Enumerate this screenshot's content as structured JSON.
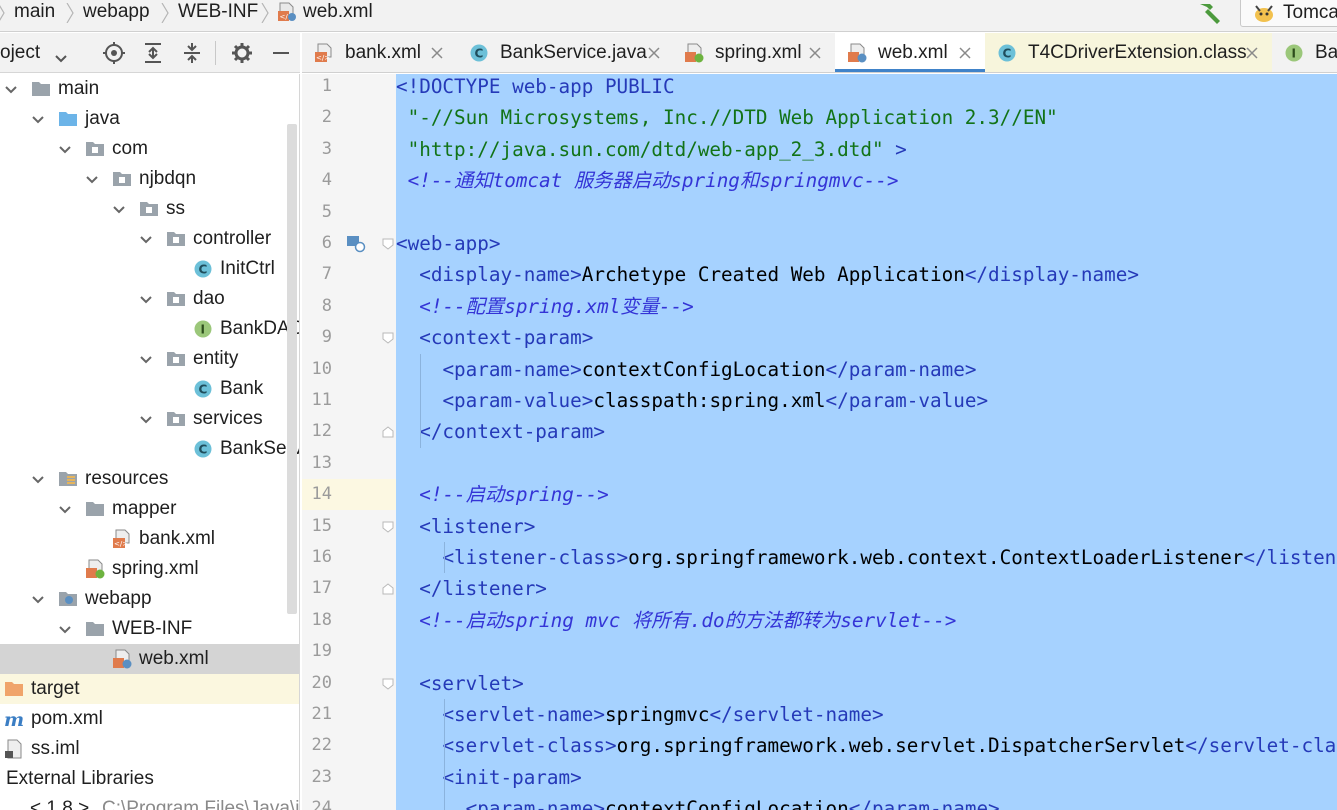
{
  "breadcrumb": [
    "main",
    "webapp",
    "WEB-INF",
    "web.xml"
  ],
  "toolbar": {
    "run_config_label": "Tomca"
  },
  "project_panel": {
    "title": "oject"
  },
  "tree": [
    {
      "label": "main",
      "chevron": "down",
      "icon": "folder-gray"
    },
    {
      "label": "java",
      "chevron": "down",
      "icon": "folder-blue"
    },
    {
      "label": "com",
      "chevron": "down",
      "icon": "package"
    },
    {
      "label": "njbdqn",
      "chevron": "down",
      "icon": "package"
    },
    {
      "label": "ss",
      "chevron": "down",
      "icon": "package"
    },
    {
      "label": "controller",
      "chevron": "down",
      "icon": "package"
    },
    {
      "label": "InitCtrl",
      "chevron": "",
      "icon": "class"
    },
    {
      "label": "dao",
      "chevron": "down",
      "icon": "package"
    },
    {
      "label": "BankDAO",
      "chevron": "",
      "icon": "interface"
    },
    {
      "label": "entity",
      "chevron": "down",
      "icon": "package"
    },
    {
      "label": "Bank",
      "chevron": "",
      "icon": "class"
    },
    {
      "label": "services",
      "chevron": "down",
      "icon": "package"
    },
    {
      "label": "BankServ",
      "chevron": "",
      "icon": "class"
    },
    {
      "label": "resources",
      "chevron": "down",
      "icon": "resources"
    },
    {
      "label": "mapper",
      "chevron": "down",
      "icon": "folder-gray"
    },
    {
      "label": "bank.xml",
      "chevron": "",
      "icon": "xml"
    },
    {
      "label": "spring.xml",
      "chevron": "",
      "icon": "spring-xml"
    },
    {
      "label": "webapp",
      "chevron": "down",
      "icon": "web-folder"
    },
    {
      "label": "WEB-INF",
      "chevron": "down",
      "icon": "folder-gray"
    },
    {
      "label": "web.xml",
      "chevron": "",
      "icon": "web-xml"
    },
    {
      "label": "target",
      "chevron": "",
      "icon": "folder-orange"
    },
    {
      "label": "pom.xml",
      "chevron": "",
      "icon": "maven"
    },
    {
      "label": "ss.iml",
      "chevron": "",
      "icon": "iml"
    },
    {
      "label": "External Libraries",
      "chevron": "",
      "icon": ""
    },
    {
      "label": "< 1.8 >",
      "chevron": "",
      "icon": ""
    }
  ],
  "tree_extra": {
    "jdk_path": "C:\\Program Files\\Java\\j"
  },
  "tabs": [
    {
      "label": "bank.xml",
      "icon": "xml"
    },
    {
      "label": "BankService.java",
      "icon": "class"
    },
    {
      "label": "spring.xml",
      "icon": "spring-xml"
    },
    {
      "label": "web.xml",
      "icon": "web-xml"
    },
    {
      "label": "T4CDriverExtension.class",
      "icon": "class"
    },
    {
      "label": "Ban",
      "icon": "interface"
    }
  ],
  "editor": {
    "line_numbers": [
      "1",
      "2",
      "3",
      "4",
      "5",
      "6",
      "7",
      "8",
      "9",
      "10",
      "11",
      "12",
      "13",
      "14",
      "15",
      "16",
      "17",
      "18",
      "19",
      "20",
      "21",
      "22",
      "23",
      "24"
    ],
    "lines": [
      [
        {
          "t": "doc",
          "v": "<!DOCTYPE web-app PUBLIC"
        }
      ],
      [
        {
          "t": "str",
          "v": " \"-//Sun Microsystems, Inc.//DTD Web Application 2.3//EN\""
        }
      ],
      [
        {
          "t": "str",
          "v": " \"http://java.sun.com/dtd/web-app_2_3.dtd\""
        },
        {
          "t": "doc",
          "v": " >"
        }
      ],
      [
        {
          "t": "cmt",
          "v": " <!--通知tomcat 服务器启动spring和springmvc-->"
        }
      ],
      [],
      [
        {
          "t": "tag",
          "v": "<web-app>"
        }
      ],
      [
        {
          "t": "txt",
          "v": "  "
        },
        {
          "t": "tag",
          "v": "<display-name>"
        },
        {
          "t": "txt",
          "v": "Archetype Created Web Application"
        },
        {
          "t": "tag",
          "v": "</display-name>"
        }
      ],
      [
        {
          "t": "txt",
          "v": "  "
        },
        {
          "t": "cmt",
          "v": "<!--配置spring.xml变量-->"
        }
      ],
      [
        {
          "t": "txt",
          "v": "  "
        },
        {
          "t": "tag",
          "v": "<context-param>"
        }
      ],
      [
        {
          "t": "txt",
          "v": "    "
        },
        {
          "t": "tag",
          "v": "<param-name>"
        },
        {
          "t": "txt",
          "v": "contextConfigLocation"
        },
        {
          "t": "tag",
          "v": "</param-name>"
        }
      ],
      [
        {
          "t": "txt",
          "v": "    "
        },
        {
          "t": "tag",
          "v": "<param-value>"
        },
        {
          "t": "txt",
          "v": "classpath:spring.xml"
        },
        {
          "t": "tag",
          "v": "</param-value>"
        }
      ],
      [
        {
          "t": "txt",
          "v": "  "
        },
        {
          "t": "tag",
          "v": "</context-param>"
        }
      ],
      [],
      [
        {
          "t": "txt",
          "v": "  "
        },
        {
          "t": "cmt",
          "v": "<!--启动spring-->"
        }
      ],
      [
        {
          "t": "txt",
          "v": "  "
        },
        {
          "t": "tag",
          "v": "<listener>"
        }
      ],
      [
        {
          "t": "txt",
          "v": "    "
        },
        {
          "t": "tag",
          "v": "<listener-class>"
        },
        {
          "t": "txt",
          "v": "org.springframework.web.context.ContextLoaderListener"
        },
        {
          "t": "tag",
          "v": "</listener-class>"
        }
      ],
      [
        {
          "t": "txt",
          "v": "  "
        },
        {
          "t": "tag",
          "v": "</listener>"
        }
      ],
      [
        {
          "t": "txt",
          "v": "  "
        },
        {
          "t": "cmt",
          "v": "<!--启动spring mvc 将所有.do的方法都转为servlet-->"
        }
      ],
      [],
      [
        {
          "t": "txt",
          "v": "  "
        },
        {
          "t": "tag",
          "v": "<servlet>"
        }
      ],
      [
        {
          "t": "txt",
          "v": "    "
        },
        {
          "t": "tag",
          "v": "<servlet-name>"
        },
        {
          "t": "txt",
          "v": "springmvc"
        },
        {
          "t": "tag",
          "v": "</servlet-name>"
        }
      ],
      [
        {
          "t": "txt",
          "v": "    "
        },
        {
          "t": "tag",
          "v": "<servlet-class>"
        },
        {
          "t": "txt",
          "v": "org.springframework.web.servlet.DispatcherServlet"
        },
        {
          "t": "tag",
          "v": "</servlet-class>"
        }
      ],
      [
        {
          "t": "txt",
          "v": "    "
        },
        {
          "t": "tag",
          "v": "<init-param>"
        }
      ],
      [
        {
          "t": "txt",
          "v": "      "
        },
        {
          "t": "tag",
          "v": "<param-name>"
        },
        {
          "t": "txt",
          "v": "contextConfigLocation"
        },
        {
          "t": "tag",
          "v": "</param-name>"
        }
      ]
    ]
  },
  "colors": {
    "selection": "#a6d2ff",
    "tag": "#2539b8",
    "string": "#127317",
    "comment": "#3434d6",
    "active_tab_underline": "#4083c9"
  }
}
